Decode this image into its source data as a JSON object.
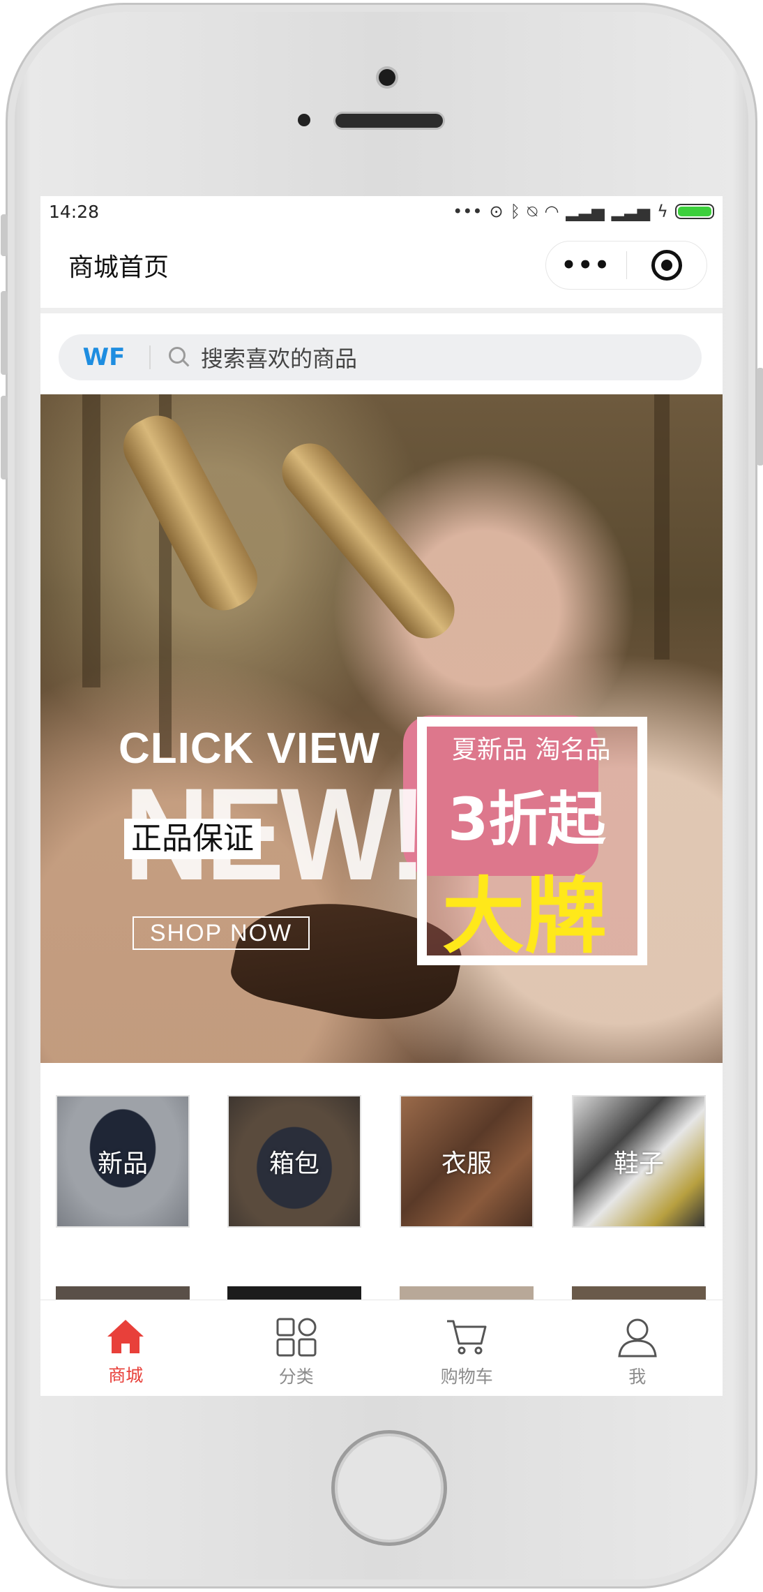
{
  "status_bar": {
    "time": "14:28"
  },
  "nav": {
    "title": "商城首页",
    "more_icon": "•••"
  },
  "search": {
    "brand": "WF",
    "placeholder": "搜索喜欢的商品"
  },
  "banner": {
    "headline": "CLICK VIEW",
    "big_text": "NEW!",
    "guarantee": "正品保证",
    "cta": "SHOP NOW",
    "promo_sub": "夏新品 淘名品",
    "promo_discount": "3折起",
    "promo_brand": "大牌"
  },
  "categories": [
    {
      "label": "新品"
    },
    {
      "label": "箱包"
    },
    {
      "label": "衣服"
    },
    {
      "label": "鞋子"
    }
  ],
  "tabbar": {
    "items": [
      {
        "label": "商城",
        "icon": "home-icon",
        "active": true
      },
      {
        "label": "分类",
        "icon": "category-icon",
        "active": false
      },
      {
        "label": "购物车",
        "icon": "cart-icon",
        "active": false
      },
      {
        "label": "我",
        "icon": "user-icon",
        "active": false
      }
    ]
  },
  "colors": {
    "accent": "#e8403a",
    "brand_blue": "#1e8de0",
    "promo_yellow": "#ffe81a"
  }
}
